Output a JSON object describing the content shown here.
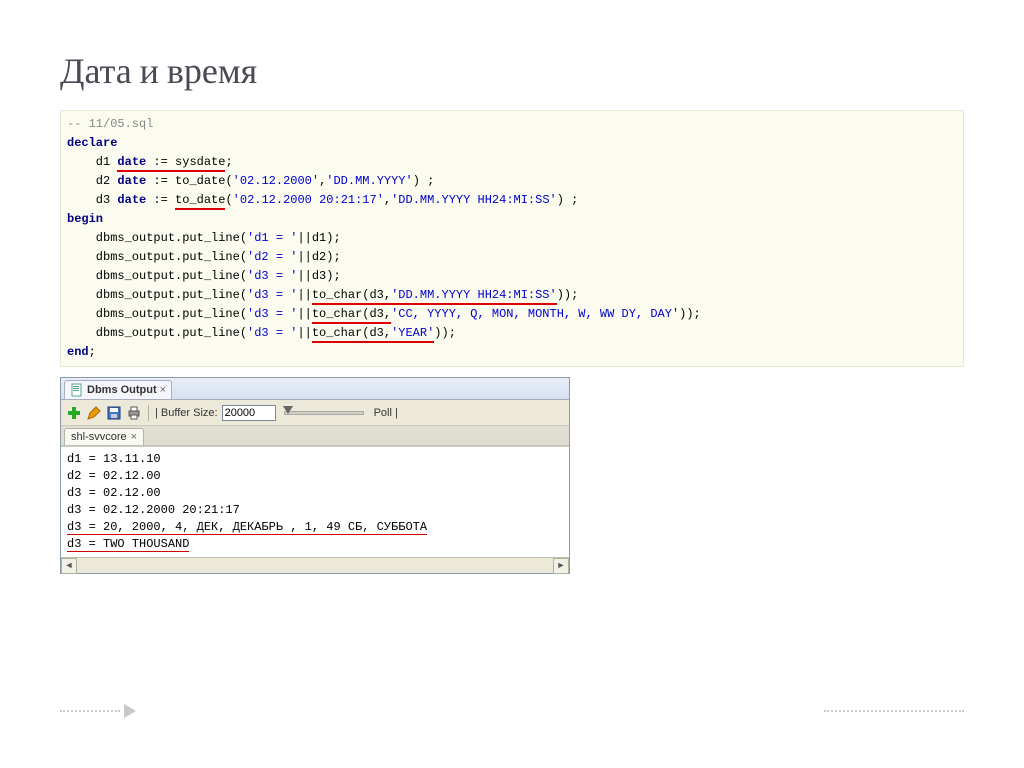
{
  "title": "Дата и время",
  "code": {
    "comment": "-- 11/05.sql",
    "kw_declare": "declare",
    "l1_pre": "    d1 ",
    "l1_kw": "date",
    "l1_mid": " := ",
    "l1_fn": "sysdate",
    "l1_end": ";",
    "l2_pre": "    d2 ",
    "l2_kw": "date",
    "l2_mid": " := to_date(",
    "l2_s1": "'02.12.2000'",
    "l2_c": ",",
    "l2_s2": "'DD.MM.YYYY'",
    "l2_end": ") ;",
    "l3_pre": "    d3 ",
    "l3_kw": "date",
    "l3_mid1": " := ",
    "l3_fn": "to_date",
    "l3_par": "(",
    "l3_s1": "'02.12.2000 20:21:17'",
    "l3_c": ",",
    "l3_s2": "'DD.MM.YYYY HH24:MI:SS'",
    "l3_end": ") ;",
    "kw_begin": "begin",
    "b1": "    dbms_output.put_line(",
    "b1s": "'d1 = '",
    "b1e": "||d1);",
    "b2": "    dbms_output.put_line(",
    "b2s": "'d2 = '",
    "b2e": "||d2);",
    "b3": "    dbms_output.put_line(",
    "b3s": "'d3 = '",
    "b3e": "||d3);",
    "b4": "    dbms_output.put_line(",
    "b4s": "'d3 = '",
    "b4m": "||",
    "b4fn": "to_char(d3,",
    "b4arg": "'DD.MM.YYYY HH24:MI:SS'",
    "b4end": "));",
    "b5": "    dbms_output.put_line(",
    "b5s": "'d3 = '",
    "b5m": "||",
    "b5fn": "to_char(d3,",
    "b5arg": "'CC, YYYY, Q, MON, MONTH, W, WW DY, DAY'",
    "b5end": "));",
    "b6": "    dbms_output.put_line(",
    "b6s": "'d3 = '",
    "b6m": "||",
    "b6fn": "to_char(d3,",
    "b6arg": "'YEAR'",
    "b6end": "));",
    "kw_end": "end",
    "semi": ";"
  },
  "panel": {
    "tab_label": "Dbms Output",
    "buffer_label": "| Buffer Size:",
    "buffer_value": "20000",
    "poll_label": "Poll |",
    "sub_tab": "shl-svvcore",
    "output_lines": [
      "d1 = 13.11.10",
      "d2 = 02.12.00",
      "d3 = 02.12.00",
      "d3 = 02.12.2000 20:21:17",
      "d3 = 20, 2000, 4, ДЕК, ДЕКАБРЬ , 1, 49 СБ, СУББОТА",
      "d3 = TWO THOUSAND"
    ]
  }
}
